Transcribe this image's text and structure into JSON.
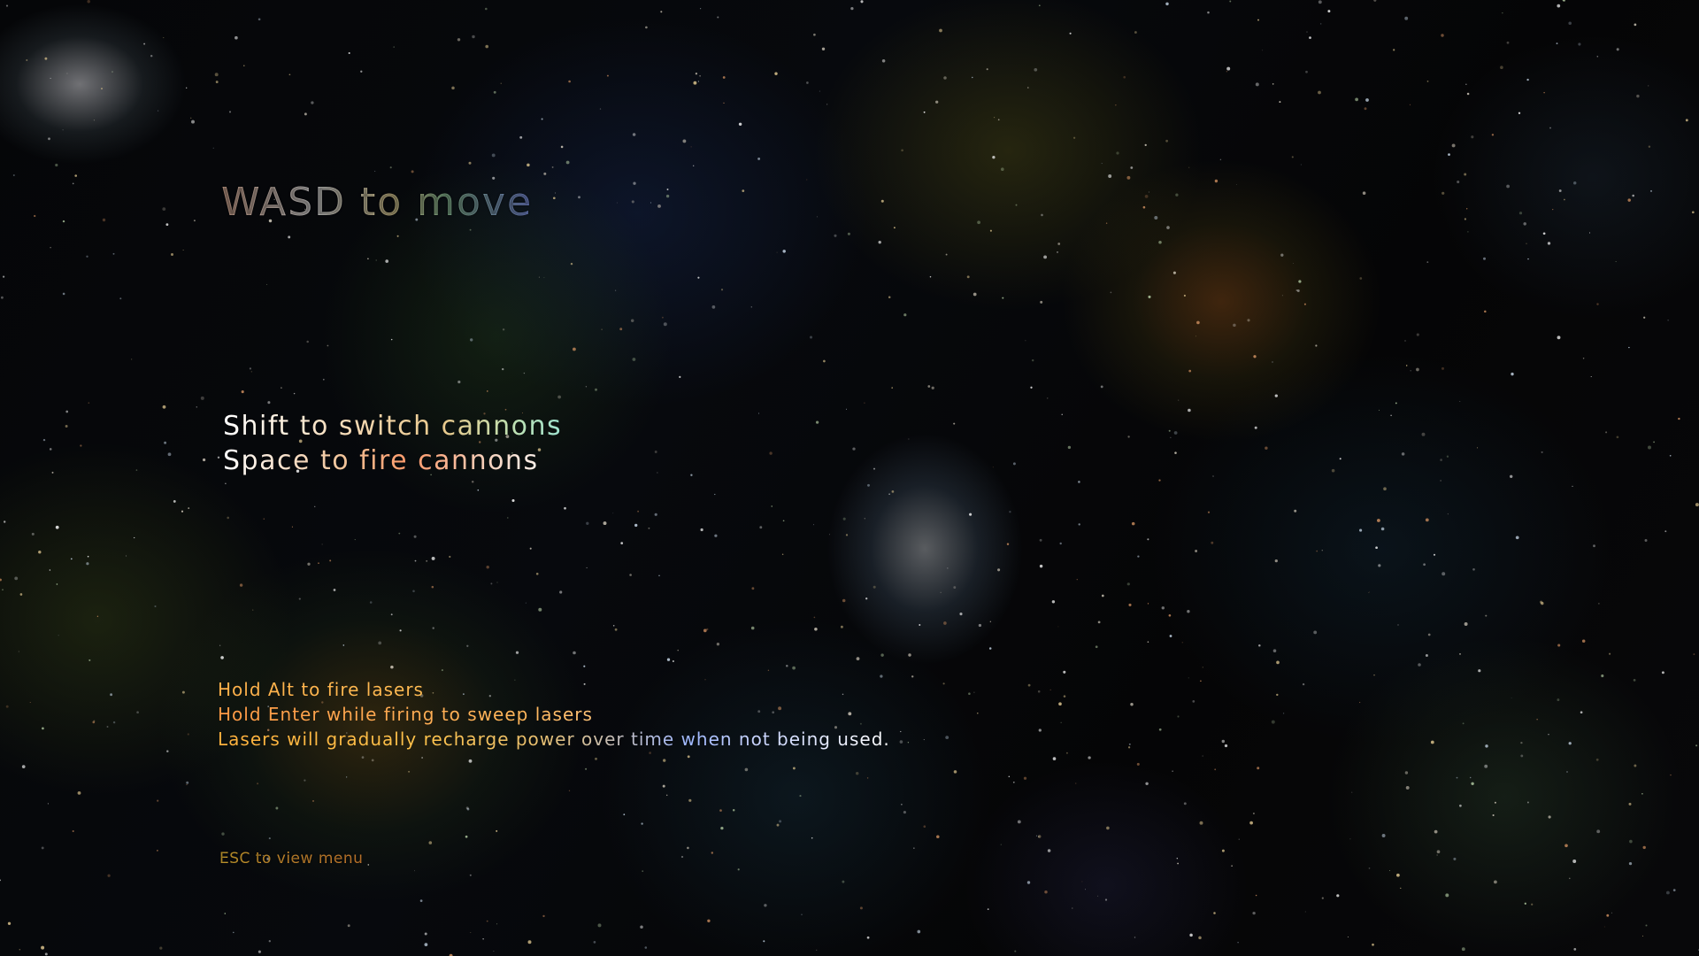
{
  "controls": {
    "move": "WASD to move",
    "cannons": [
      "Shift to switch cannons",
      "Space to fire cannons"
    ],
    "lasers": [
      "Hold Alt to fire lasers",
      "Hold Enter while firing to sweep lasers",
      "Lasers will gradually recharge power over time when not being used."
    ],
    "menu_hint": "ESC to view menu"
  },
  "colors": {
    "background": "#030304",
    "laser_text": "#ffb04a",
    "menu_hint_text": "#ffc93a",
    "heading_text": "#ffffff"
  }
}
